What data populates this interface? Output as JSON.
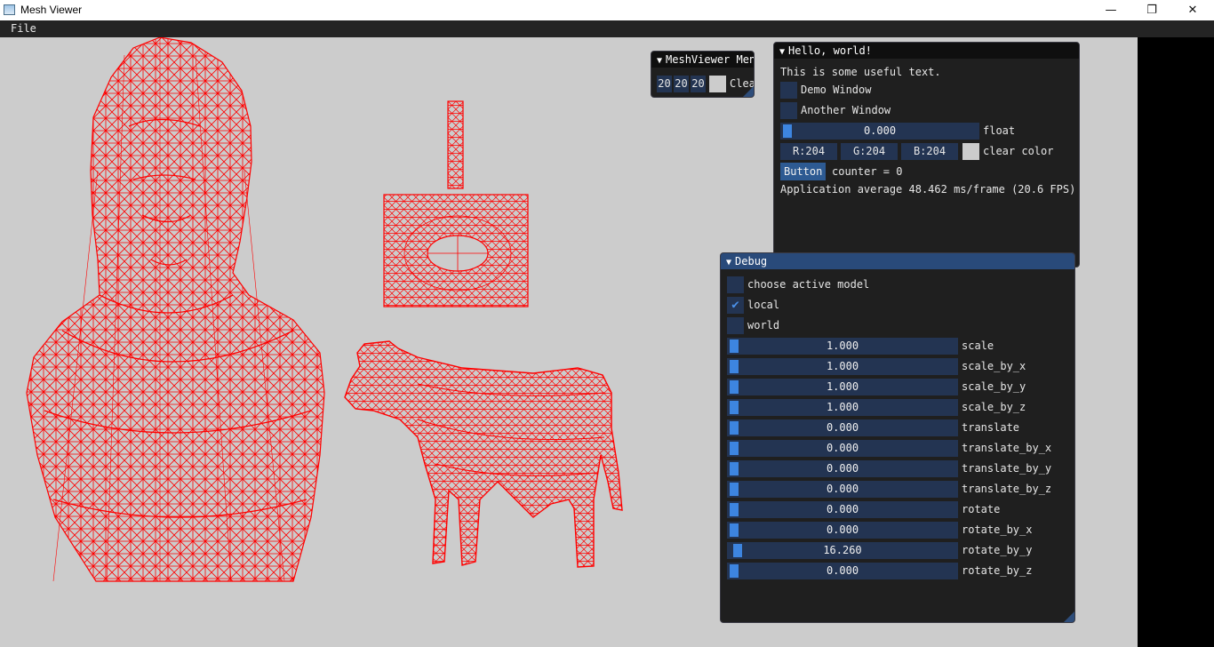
{
  "window": {
    "title": "Mesh Viewer",
    "minimize": "—",
    "maximize": "❐",
    "close": "✕"
  },
  "menu": {
    "file": "File"
  },
  "meshviewer_window": {
    "title": "MeshViewer Menu",
    "v1": "20",
    "v2": "20",
    "v3": "20",
    "clear_label": "Clear"
  },
  "hello_window": {
    "title": "Hello, world!",
    "text": "This is some useful text.",
    "demo_window": "Demo Window",
    "another_window": "Another Window",
    "float_value": "0.000",
    "float_label": "float",
    "r": "R:204",
    "g": "G:204",
    "b": "B:204",
    "clear_color_label": "clear color",
    "button_label": "Button",
    "counter": "counter = 0",
    "fps": "Application average 48.462 ms/frame (20.6 FPS)"
  },
  "debug_window": {
    "title": "Debug",
    "choose_active_model": "choose active model",
    "local": "local",
    "world": "world",
    "local_checked": true,
    "sliders": [
      {
        "label": "scale",
        "value": "1.000"
      },
      {
        "label": "scale_by_x",
        "value": "1.000"
      },
      {
        "label": "scale_by_y",
        "value": "1.000"
      },
      {
        "label": "scale_by_z",
        "value": "1.000"
      },
      {
        "label": "translate",
        "value": "0.000"
      },
      {
        "label": "translate_by_x",
        "value": "0.000"
      },
      {
        "label": "translate_by_y",
        "value": "0.000"
      },
      {
        "label": "translate_by_z",
        "value": "0.000"
      },
      {
        "label": "rotate",
        "value": "0.000"
      },
      {
        "label": "rotate_by_x",
        "value": "0.000"
      },
      {
        "label": "rotate_by_y",
        "value": "16.260"
      },
      {
        "label": "rotate_by_z",
        "value": "0.000"
      }
    ]
  },
  "colors": {
    "wire": "#ff0000",
    "background": "#cccccc",
    "accent": "#3d85e0"
  }
}
